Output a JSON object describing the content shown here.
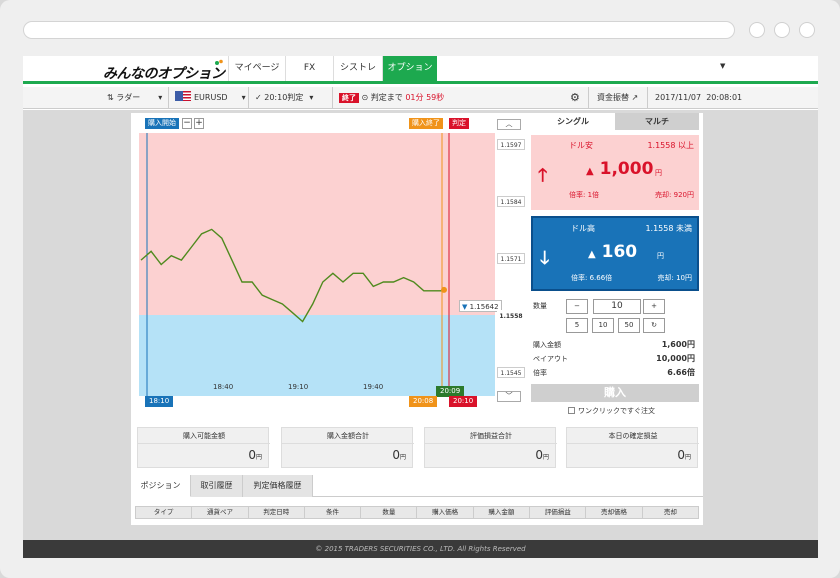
{
  "nav": {
    "logo": "みんなのオプション",
    "tabs": [
      {
        "label": "マイページ",
        "active": false
      },
      {
        "label": "FX",
        "active": false
      },
      {
        "label": "シストレ",
        "active": false
      },
      {
        "label": "オプション",
        "active": true
      }
    ]
  },
  "toolbar": {
    "mode": "ラダー",
    "pair": "EURUSD",
    "judge_time": "20:10判定",
    "status_badge": "終了",
    "until_label": "判定まで",
    "countdown": "01分 59秒",
    "funds": "資金振替",
    "date": "2017/11/07",
    "time": "20:08:01"
  },
  "chart": {
    "btn_start": "購入開始",
    "btn_end": "購入終了",
    "btn_judge": "判定",
    "price_flag": "1.15642",
    "x_ticks": [
      "18:40",
      "19:10",
      "19:40"
    ],
    "time_start": "18:10",
    "time_cursor": "20:09",
    "time_end": "20:08",
    "time_judge": "20:10",
    "y_labels": [
      "1.1597",
      "1.1584",
      "1.1571",
      "1.1558",
      "1.1545"
    ]
  },
  "chart_data": {
    "type": "line",
    "title": "",
    "xlabel": "",
    "ylabel": "",
    "x_ticks": [
      "18:40",
      "19:10",
      "19:40"
    ],
    "ylim": [
      1.154,
      1.16
    ],
    "target_rate": 1.1558,
    "last_price": 1.15642,
    "series": [
      {
        "values": [
          1.1571,
          1.1573,
          1.157,
          1.1572,
          1.1571,
          1.1574,
          1.1577,
          1.1578,
          1.1576,
          1.1571,
          1.1566,
          1.1566,
          1.1563,
          1.1562,
          1.1561,
          1.1559,
          1.1557,
          1.1561,
          1.1566,
          1.1568,
          1.1566,
          1.1568,
          1.1568,
          1.1565,
          1.1566,
          1.1566,
          1.1567,
          1.1566,
          1.1564,
          1.1564,
          1.1564
        ]
      }
    ]
  },
  "side": {
    "tab_single": "シングル",
    "tab_multi": "マルチ",
    "up": {
      "label": "ドル安",
      "cond": "1.1558 以上",
      "price": "1,000",
      "unit": "円",
      "rate": "倍率: 1倍",
      "sell": "売却: 920円"
    },
    "down": {
      "label": "ドル高",
      "cond": "1.1558 未満",
      "price": "160",
      "unit": "円",
      "rate": "倍率: 6.66倍",
      "sell": "売却: 10円"
    },
    "qty_label": "数量",
    "qty_value": "10",
    "qty_minus": "−",
    "qty_plus": "+",
    "presets": [
      "5",
      "10",
      "50"
    ],
    "reset": "↻",
    "buy_amount_label": "購入金額",
    "buy_amount": "1,600円",
    "payout_label": "ペイアウト",
    "payout": "10,000円",
    "rate_label": "倍率",
    "rate": "6.66倍",
    "buy_button": "購入",
    "oneclick": "ワンクリックですぐ注文"
  },
  "summary": [
    {
      "label": "購入可能金額",
      "value": "0",
      "unit": "円"
    },
    {
      "label": "購入金額合計",
      "value": "0",
      "unit": "円"
    },
    {
      "label": "評価損益合計",
      "value": "0",
      "unit": "円"
    },
    {
      "label": "本日の確定損益",
      "value": "0",
      "unit": "円"
    }
  ],
  "bottom_tabs": [
    "ポジション",
    "取引履歴",
    "判定価格履歴"
  ],
  "table_headers": [
    "タイプ",
    "通貨ペア",
    "判定日時",
    "条件",
    "数量",
    "購入価格",
    "購入金額",
    "評価損益",
    "売却価格",
    "売却"
  ],
  "footer": "© 2015 TRADERS SECURITIES CO., LTD. All Rights Reserved",
  "colors": {
    "brand_green": "#1da94f",
    "up_red": "#d9122a",
    "down_blue": "#1973b8",
    "line_green": "#4f8a1e"
  }
}
